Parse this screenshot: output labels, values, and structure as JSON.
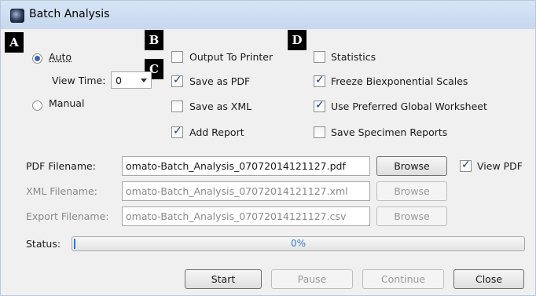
{
  "window": {
    "title": "Batch Analysis",
    "icon": "app-icon"
  },
  "markers": [
    "A",
    "B",
    "C",
    "D"
  ],
  "mode": {
    "auto_label": "Auto",
    "manual_label": "Manual",
    "selected": "Auto",
    "view_time_label": "View Time:",
    "view_time_value": "0"
  },
  "options_col1": {
    "output_to_printer": {
      "label": "Output To Printer",
      "checked": false
    },
    "save_as_pdf": {
      "label": "Save as PDF",
      "checked": true
    },
    "save_as_xml": {
      "label": "Save as XML",
      "checked": false
    },
    "add_report": {
      "label": "Add Report",
      "checked": true
    }
  },
  "options_col2": {
    "statistics": {
      "label": "Statistics",
      "checked": false
    },
    "freeze_biexponential": {
      "label": "Freeze Biexponential Scales",
      "checked": true
    },
    "use_preferred_worksheet": {
      "label": "Use Preferred Global Worksheet",
      "checked": true
    },
    "save_specimen_reports": {
      "label": "Save Specimen Reports",
      "checked": false
    }
  },
  "files": {
    "pdf": {
      "label": "PDF Filename:",
      "value": "omato-Batch_Analysis_07072014121127.pdf",
      "browse": "Browse",
      "enabled": true
    },
    "xml": {
      "label": "XML Filename:",
      "value": "omato-Batch_Analysis_07072014121127.xml",
      "browse": "Browse",
      "enabled": false
    },
    "export": {
      "label": "Export Filename:",
      "value": "omato-Batch_Analysis_07072014121127.csv",
      "browse": "Browse",
      "enabled": false
    },
    "view_pdf": {
      "label": "View PDF",
      "checked": true
    }
  },
  "status": {
    "label": "Status:",
    "progress_text": "0%",
    "progress": 0
  },
  "buttons": {
    "start": "Start",
    "pause": "Pause",
    "continue": "Continue",
    "close": "Close"
  },
  "colors": {
    "titlebar": "#c7d8ee",
    "accent": "#3a67b0",
    "progress_text": "#3b78d0"
  }
}
